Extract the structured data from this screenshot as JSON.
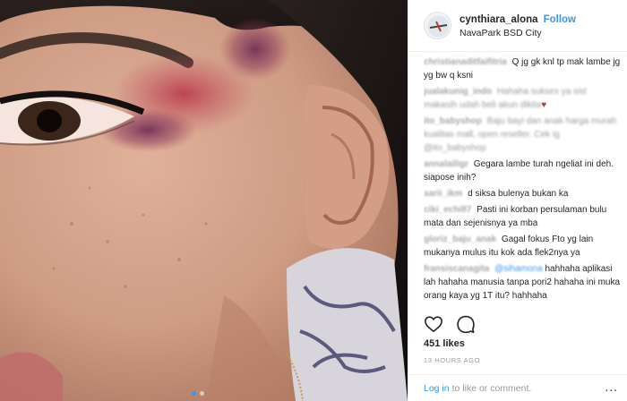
{
  "post": {
    "username": "cynthiara_alona",
    "follow_label": "Follow",
    "location": "NavaPark BSD City",
    "likes": "451 likes",
    "timestamp": "13 HOURS AGO",
    "login_link": "Log in",
    "login_suffix": "to like or comment.",
    "more_label": "..."
  },
  "comments": [
    {
      "user": "christianaditfaifitria",
      "text": "Q jg gk knl tp mak lambe jg yg bw q ksni",
      "user_blurred": true,
      "text_blurred": false
    },
    {
      "user": "jualakunig_indo",
      "text": "Hahaha sukses ya sist makasih udah beli akun dikita",
      "user_blurred": true,
      "text_blurred": true
    },
    {
      "user": "ito_babyshop",
      "text": "Baju bayi dan anak harga murah kualitas mall, open reseller. Cek ig @ito_babyshop",
      "user_blurred": true,
      "text_blurred": true
    },
    {
      "user": "annalailigr",
      "text": "Gegara lambe turah ngeliat ini deh. siapose inih?",
      "user_blurred": true,
      "text_blurred": false
    },
    {
      "user": "sarii_ikm",
      "text": "d siksa bulenya bukan ka",
      "user_blurred": true,
      "text_blurred": false
    },
    {
      "user": "ciki_echi87",
      "text": "Pasti ini korban persulaman bulu mata dan sejenisnya ya mba",
      "user_blurred": true,
      "text_blurred": false
    },
    {
      "user": "gloriz_baju_anak",
      "text": "Gagal fokus Fto yg lain mukanya mulus itu kok ada flek2nya ya",
      "user_blurred": true,
      "text_blurred": false
    },
    {
      "user": "fransiscanagita",
      "mention": "@sihamona",
      "text": "hahhaha aplikasi lah hahaha manusia tanpa pori2 hahaha ini muka orang kaya yg 1T itu? hahhaha",
      "user_blurred": true,
      "text_blurred": false
    }
  ],
  "icons": {
    "heart": "heart-icon",
    "comment": "comment-icon",
    "avatar": "avatar"
  },
  "colors": {
    "link_blue": "#3897f0",
    "text_dark": "#262626",
    "muted": "#999999",
    "border": "#efefef"
  },
  "carousel": {
    "count": 2,
    "active_index": 0
  }
}
